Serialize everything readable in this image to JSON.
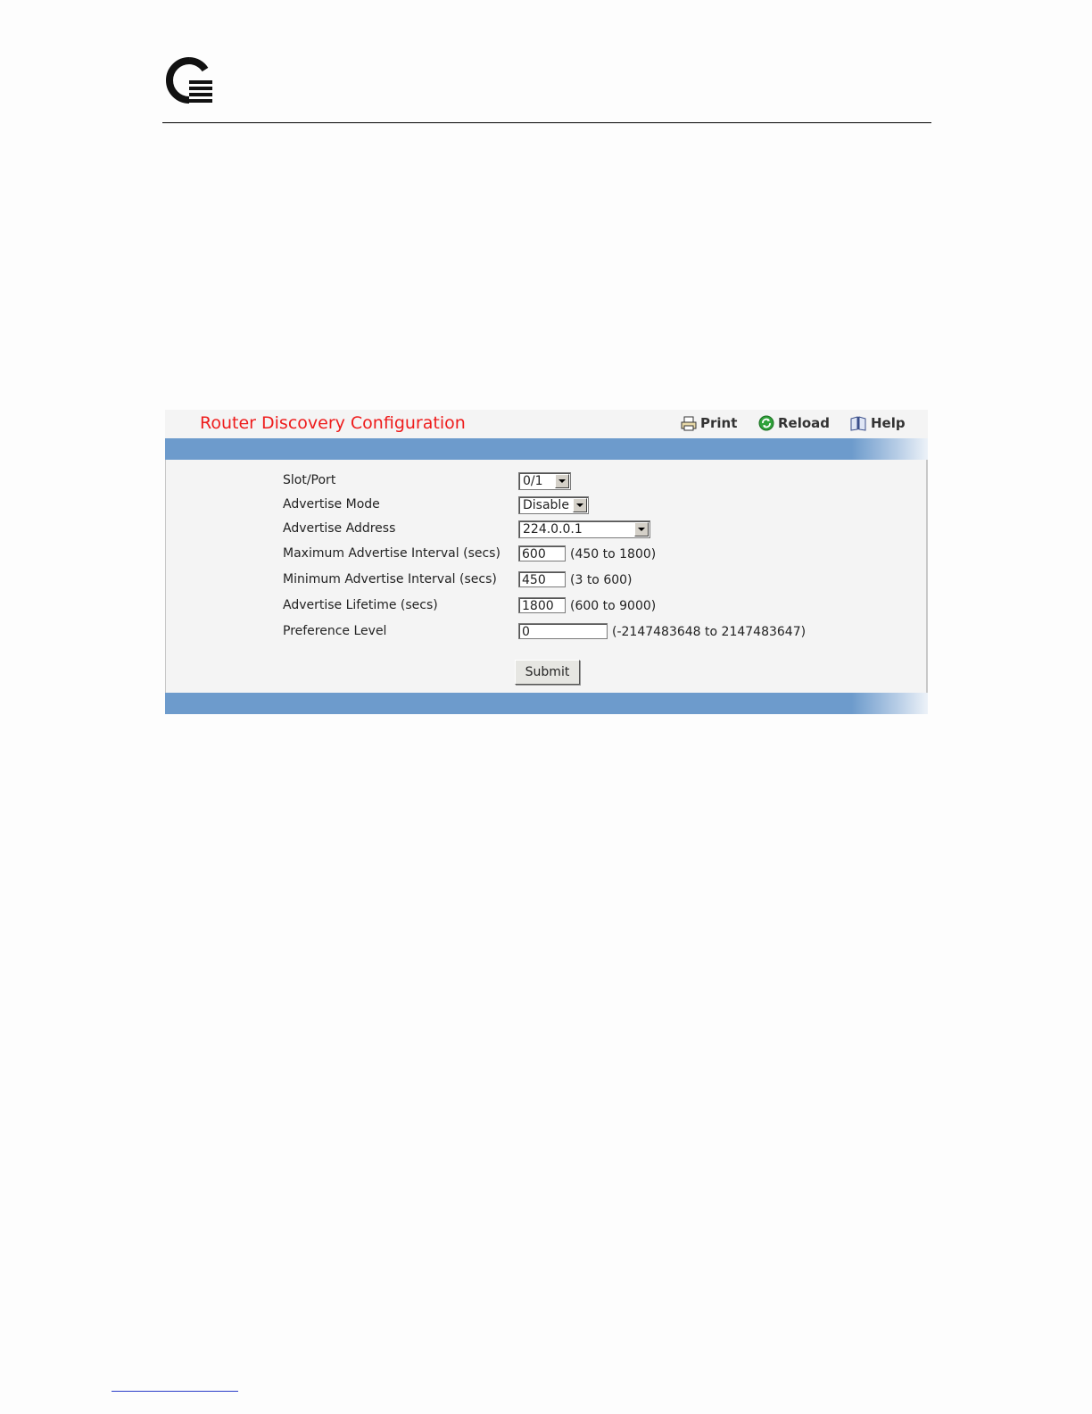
{
  "page": {
    "logo_icon": "q-logo-icon"
  },
  "panel": {
    "title": "Router Discovery Configuration",
    "actions": {
      "print_label": "Print",
      "reload_label": "Reload",
      "help_label": "Help"
    },
    "colors": {
      "title": "#ee1c1c",
      "band": "#6d9bcc",
      "panel_bg": "#f4f4f4"
    }
  },
  "form": {
    "slot_port": {
      "label": "Slot/Port",
      "value": "0/1"
    },
    "advertise_mode": {
      "label": "Advertise Mode",
      "value": "Disable"
    },
    "advertise_address": {
      "label": "Advertise Address",
      "value": "224.0.0.1"
    },
    "max_interval": {
      "label": "Maximum Advertise Interval (secs)",
      "value": "600",
      "range": "(450 to 1800)"
    },
    "min_interval": {
      "label": "Minimum Advertise Interval (secs)",
      "value": "450",
      "range": "(3 to 600)"
    },
    "lifetime": {
      "label": "Advertise Lifetime (secs)",
      "value": "1800",
      "range": "(600 to 9000)"
    },
    "preference": {
      "label": "Preference Level",
      "value": "0",
      "range": "(-2147483648 to 2147483647)"
    },
    "submit_label": "Submit"
  }
}
